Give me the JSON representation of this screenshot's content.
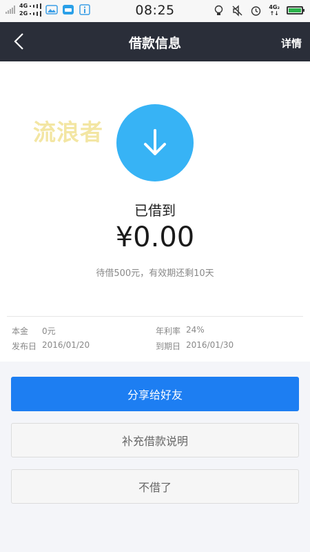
{
  "status_bar": {
    "net_top": "4G",
    "net_bottom": "2G",
    "time": "08:25",
    "net_right": "4G₂"
  },
  "nav": {
    "title": "借款信息",
    "detail_link": "详情"
  },
  "watermark": "流浪者",
  "loan": {
    "status_label": "已借到",
    "amount": "¥0.00",
    "note": "待借500元，有效期还剩10天"
  },
  "details": {
    "principal_label": "本金",
    "principal_value": "0元",
    "rate_label": "年利率",
    "rate_value": "24%",
    "publish_label": "发布日",
    "publish_value": "2016/01/20",
    "due_label": "到期日",
    "due_value": "2016/01/30"
  },
  "buttons": {
    "share": "分享给好友",
    "supplement": "补充借款说明",
    "cancel": "不借了"
  },
  "colors": {
    "nav_bg": "#2a2e39",
    "circle": "#37b3f5",
    "primary_button": "#1d7ef2"
  }
}
